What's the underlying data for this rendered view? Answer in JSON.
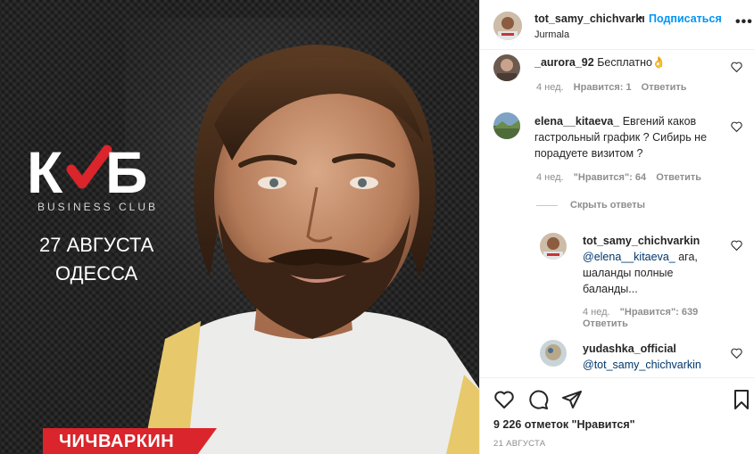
{
  "post": {
    "brand": {
      "logo_text": "КЛБ",
      "subtitle": "BUSINESS CLUB"
    },
    "event_date": "27 АВГУСТА",
    "event_city": "ОДЕССА",
    "name_banner": "ЧИЧВАРКИН"
  },
  "header": {
    "username": "tot_samy_chichvarkı",
    "separator": "•",
    "follow_label": "Подписаться",
    "location": "Jurmala",
    "more_icon": "ellipsis-icon"
  },
  "comments": [
    {
      "username": "_aurora_92",
      "text": "Бесплатно👌",
      "age": "4 нед.",
      "likes": "Нравится: 1",
      "reply": "Ответить"
    },
    {
      "username": "elena__kitaeva_",
      "text": "Евгений каков гастрольный график ? Сибирь не порадуете визитом ?",
      "age": "4 нед.",
      "likes": "\"Нравится\": 64",
      "reply": "Ответить"
    }
  ],
  "hide_replies": "Скрыть ответы",
  "replies": [
    {
      "username": "tot_samy_chichvarkin",
      "mention": "@elena__kitaeva_",
      "text": "ага, шаланды полные баланды...",
      "age": "4 нед.",
      "likes": "\"Нравится\": 639",
      "reply": "Ответить"
    },
    {
      "username": "yudashka_official",
      "mention": "@tot_samy_chichvarkin",
      "text": ""
    }
  ],
  "actions": {
    "like_icon": "heart-icon",
    "comment_icon": "comment-icon",
    "share_icon": "share-icon",
    "save_icon": "bookmark-icon"
  },
  "likes_count": "9 226 отметок \"Нравится\"",
  "post_date": "21 АВГУСТА",
  "colors": {
    "accent_blue": "#0095f6",
    "link_blue": "#00376b",
    "banner_red": "#d9252b",
    "muted_gray": "#8e8e8e"
  }
}
